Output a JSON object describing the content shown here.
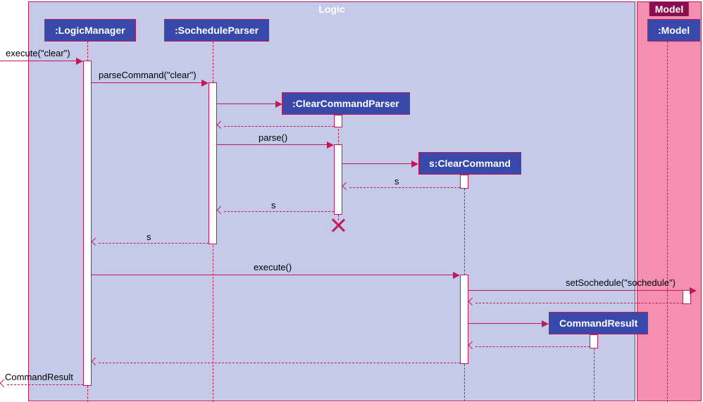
{
  "frames": {
    "logic": "Logic",
    "model": "Model"
  },
  "participants": {
    "logicManager": ":LogicManager",
    "socheduleParser": ":SocheduleParser",
    "clearCommandParser": ":ClearCommandParser",
    "clearCommand": "s:ClearCommand",
    "model": ":Model",
    "commandResult": "CommandResult"
  },
  "messages": {
    "execute1": "execute(\"clear\")",
    "parseCommand": "parseCommand(\"clear\")",
    "parse": "parse()",
    "return_s1": "s",
    "return_s2": "s",
    "return_s3": "s",
    "execute2": "execute()",
    "setSochedule": "setSochedule(\"sochedule\")",
    "returnCommandResult": "CommandResult"
  },
  "chart_data": {
    "type": "sequence_diagram",
    "frames": [
      {
        "name": "Logic",
        "participants": [
          "LogicManager",
          "SocheduleParser",
          "ClearCommandParser",
          "ClearCommand",
          "CommandResult"
        ]
      },
      {
        "name": "Model",
        "participants": [
          "Model"
        ]
      }
    ],
    "lifelines": [
      {
        "id": "LogicManager",
        "label": ":LogicManager"
      },
      {
        "id": "SocheduleParser",
        "label": ":SocheduleParser"
      },
      {
        "id": "ClearCommandParser",
        "label": ":ClearCommandParser",
        "created_by": "parseCommand",
        "destroyed": true
      },
      {
        "id": "ClearCommand",
        "label": "s:ClearCommand",
        "created_by": "parse"
      },
      {
        "id": "Model",
        "label": ":Model"
      },
      {
        "id": "CommandResult",
        "label": "CommandResult",
        "created_by": "execute"
      }
    ],
    "messages": [
      {
        "from": "external",
        "to": "LogicManager",
        "label": "execute(\"clear\")",
        "type": "sync"
      },
      {
        "from": "LogicManager",
        "to": "SocheduleParser",
        "label": "parseCommand(\"clear\")",
        "type": "sync"
      },
      {
        "from": "SocheduleParser",
        "to": "ClearCommandParser",
        "label": "",
        "type": "create"
      },
      {
        "from": "ClearCommandParser",
        "to": "SocheduleParser",
        "label": "",
        "type": "return"
      },
      {
        "from": "SocheduleParser",
        "to": "ClearCommandParser",
        "label": "parse()",
        "type": "sync"
      },
      {
        "from": "ClearCommandParser",
        "to": "ClearCommand",
        "label": "",
        "type": "create"
      },
      {
        "from": "ClearCommand",
        "to": "ClearCommandParser",
        "label": "s",
        "type": "return"
      },
      {
        "from": "ClearCommandParser",
        "to": "SocheduleParser",
        "label": "s",
        "type": "return"
      },
      {
        "from": "SocheduleParser",
        "to": "LogicManager",
        "label": "s",
        "type": "return"
      },
      {
        "from": "LogicManager",
        "to": "ClearCommand",
        "label": "execute()",
        "type": "sync"
      },
      {
        "from": "ClearCommand",
        "to": "Model",
        "label": "setSochedule(\"sochedule\")",
        "type": "sync"
      },
      {
        "from": "Model",
        "to": "ClearCommand",
        "label": "",
        "type": "return"
      },
      {
        "from": "ClearCommand",
        "to": "CommandResult",
        "label": "",
        "type": "create"
      },
      {
        "from": "CommandResult",
        "to": "ClearCommand",
        "label": "",
        "type": "return"
      },
      {
        "from": "ClearCommand",
        "to": "LogicManager",
        "label": "",
        "type": "return"
      },
      {
        "from": "LogicManager",
        "to": "external",
        "label": "CommandResult",
        "type": "return"
      }
    ]
  }
}
